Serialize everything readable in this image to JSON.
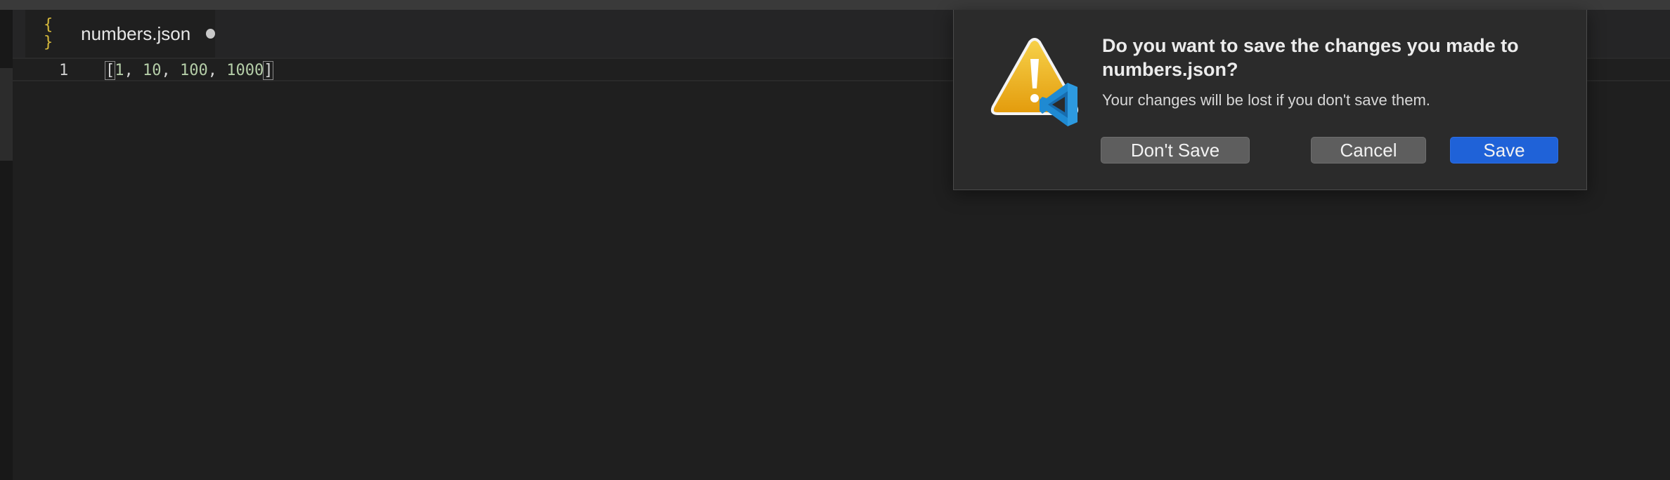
{
  "editor": {
    "tab": {
      "icon": "{ }",
      "filename": "numbers.json",
      "dirty": true
    },
    "lines": [
      {
        "number": "1",
        "open_bracket": "[",
        "values": [
          "1",
          "10",
          "100",
          "1000"
        ],
        "close_bracket": "]",
        "separator": ", "
      }
    ]
  },
  "dialog": {
    "title": "Do you want to save the changes you made to numbers.json?",
    "message": "Your changes will be lost if you don't save them.",
    "buttons": {
      "dont_save": "Don't Save",
      "cancel": "Cancel",
      "save": "Save"
    },
    "icon": "warning-with-vscode-icon"
  },
  "colors": {
    "accent_button": "#1f62d8",
    "json_icon": "#d7ba3c",
    "number_literal": "#b5cea8",
    "warning_yellow": "#f0b512",
    "vscode_blue": "#1f8ad2"
  }
}
